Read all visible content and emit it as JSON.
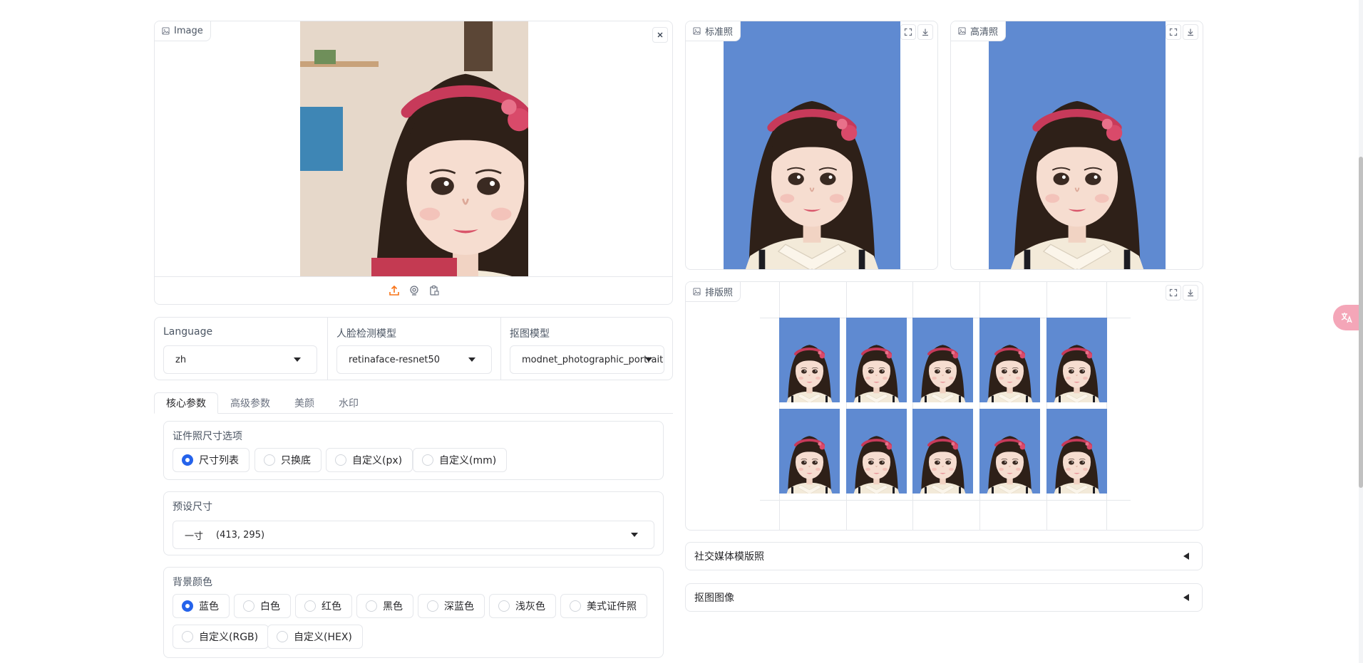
{
  "input_image": {
    "label": "Image"
  },
  "outputs": {
    "standard": {
      "label": "标准照"
    },
    "hd": {
      "label": "高清照"
    },
    "layout": {
      "label": "排版照"
    }
  },
  "settings": {
    "language": {
      "label": "Language",
      "value": "zh"
    },
    "face_model": {
      "label": "人脸检测模型",
      "value": "retinaface-resnet50"
    },
    "matting_model": {
      "label": "抠图模型",
      "value": "modnet_photographic_portrait"
    }
  },
  "tabs": [
    "核心参数",
    "高级参数",
    "美颜",
    "水印"
  ],
  "size_options": {
    "label": "证件照尺寸选项",
    "options": [
      "尺寸列表",
      "只换底",
      "自定义(px)",
      "自定义(mm)"
    ],
    "selected": 0
  },
  "preset": {
    "label": "预设尺寸",
    "value": "一寸",
    "dims": "(413, 295)"
  },
  "bg_color": {
    "label": "背景颜色",
    "options": [
      "蓝色",
      "白色",
      "红色",
      "黑色",
      "深蓝色",
      "浅灰色",
      "美式证件照",
      "自定义(RGB)",
      "自定义(HEX)"
    ],
    "selected": 0
  },
  "accordions": {
    "social": "社交媒体模版照",
    "matting": "抠图图像"
  },
  "colors": {
    "accent": "#2563eb",
    "upload": "#f97316",
    "id_bg": "#5f8ad1"
  }
}
